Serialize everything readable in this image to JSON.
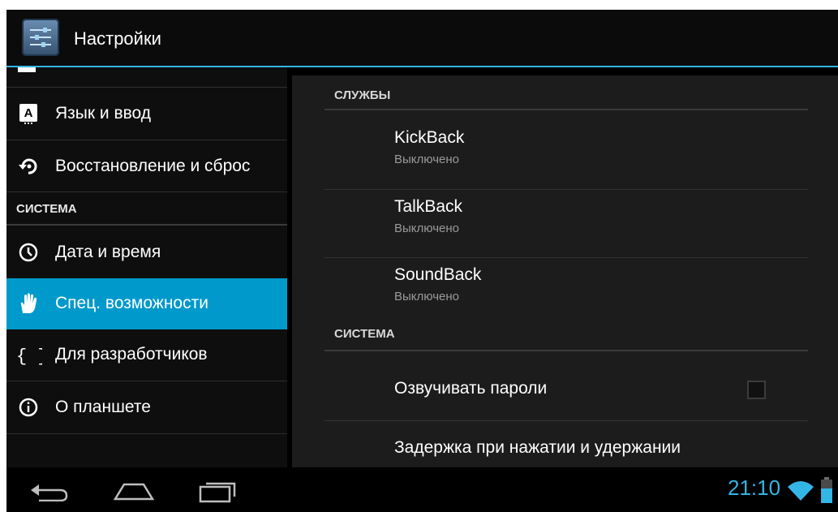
{
  "app": {
    "title": "Настройки"
  },
  "sidebar": {
    "items": [
      {
        "label": "Язык и ввод",
        "icon": "language-icon"
      },
      {
        "label": "Восстановление и сброс",
        "icon": "backup-reset-icon"
      },
      {
        "label": "Дата и время",
        "icon": "clock-icon"
      },
      {
        "label": "Спец. возможности",
        "icon": "hand-icon",
        "selected": true
      },
      {
        "label": "Для разработчиков",
        "icon": "braces-icon"
      },
      {
        "label": "О планшете",
        "icon": "info-icon"
      }
    ],
    "section_system": "СИСТЕМА"
  },
  "main": {
    "section_services": "СЛУЖБЫ",
    "services": [
      {
        "title": "KickBack",
        "status": "Выключено"
      },
      {
        "title": "TalkBack",
        "status": "Выключено"
      },
      {
        "title": "SoundBack",
        "status": "Выключено"
      }
    ],
    "section_system": "СИСТЕМА",
    "speak_passwords": {
      "label": "Озвучивать пароли",
      "checked": false
    },
    "touch_hold_delay": {
      "label": "Задержка при нажатии и удержании"
    }
  },
  "statusbar": {
    "time": "21:10"
  },
  "colors": {
    "accent": "#33b5e5",
    "selected": "#0099cc"
  }
}
